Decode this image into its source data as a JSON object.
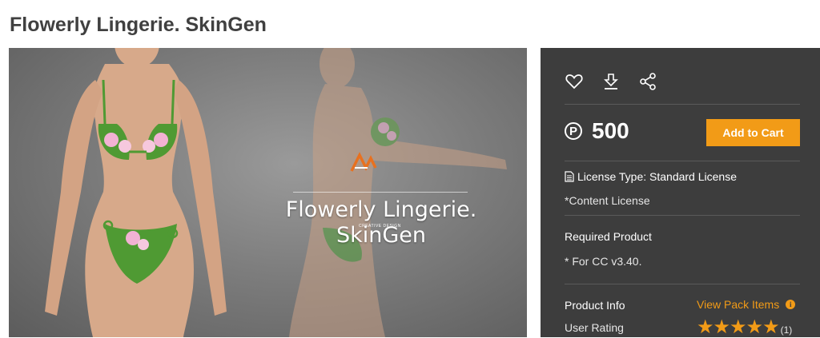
{
  "page": {
    "title": "Flowerly Lingerie. SkinGen"
  },
  "hero": {
    "logo_text": "CREATIVE DESIGN",
    "title_line1": "Flowerly  Lingerie.",
    "title_line2": "SkinGen"
  },
  "panel": {
    "icons": [
      "heart-icon",
      "download-icon",
      "share-icon"
    ],
    "currency_symbol": "P",
    "price": "500",
    "add_to_cart_label": "Add to Cart",
    "license_type": "License Type: Standard License",
    "content_license": "*Content License",
    "required_product_heading": "Required Product",
    "required_product_value": "* For CC v3.40.",
    "product_info_heading": "Product Info",
    "view_pack_items_label": "View Pack Items",
    "user_rating_label": "User Rating",
    "rating_stars": "★★★★★",
    "rating_count": "(1)"
  },
  "colors": {
    "accent": "#f29b17",
    "panel_bg": "#3d3d3d"
  }
}
